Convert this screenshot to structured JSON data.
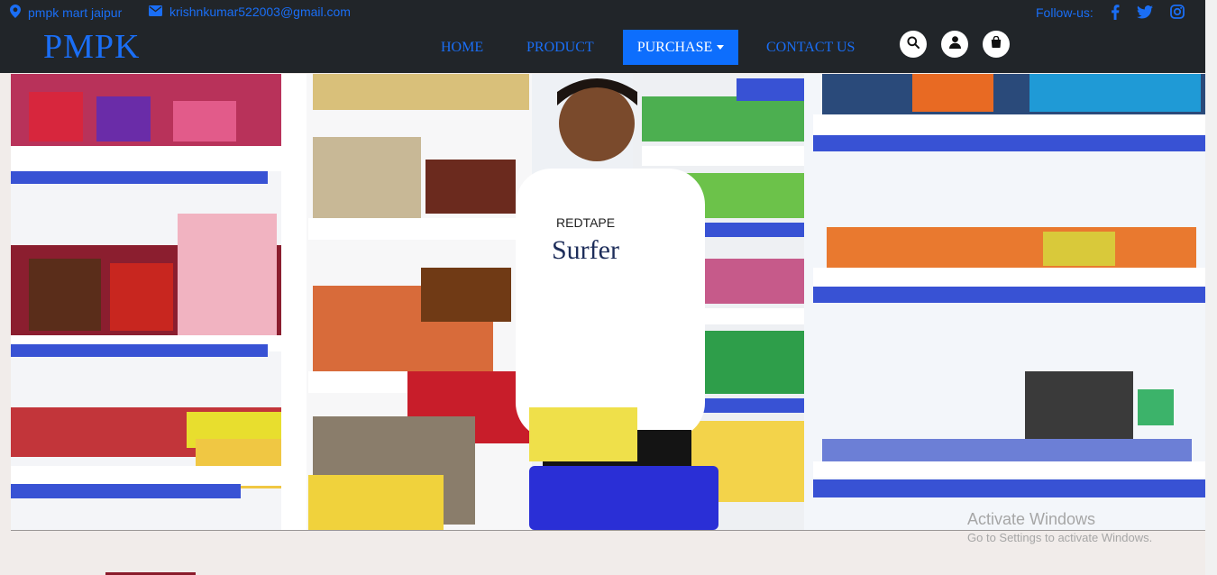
{
  "topbar": {
    "location": "pmpk mart jaipur",
    "email": "krishnkumar522003@gmail.com",
    "follow_label": "Follow-us:",
    "location_icon": "map-pin-icon",
    "email_icon": "envelope-icon",
    "social": [
      "facebook-icon",
      "twitter-icon",
      "instagram-icon"
    ]
  },
  "brand": {
    "logo": "PMPK"
  },
  "nav": {
    "home": "HOME",
    "product": "PRODUCT",
    "purchase": "PURCHASE",
    "contact": "CONTACT US"
  },
  "actions": [
    "search-icon",
    "user-icon",
    "shopping-bag-icon"
  ],
  "hero": {
    "image": "grocery store aisle photo"
  },
  "watermark": {
    "title": "Activate Windows",
    "subtitle": "Go to Settings to activate Windows."
  },
  "colors": {
    "header_bg": "#212529",
    "accent_blue": "#1a6ef5",
    "active_tab": "#0d6efd",
    "page_bg": "#f1ecea"
  }
}
